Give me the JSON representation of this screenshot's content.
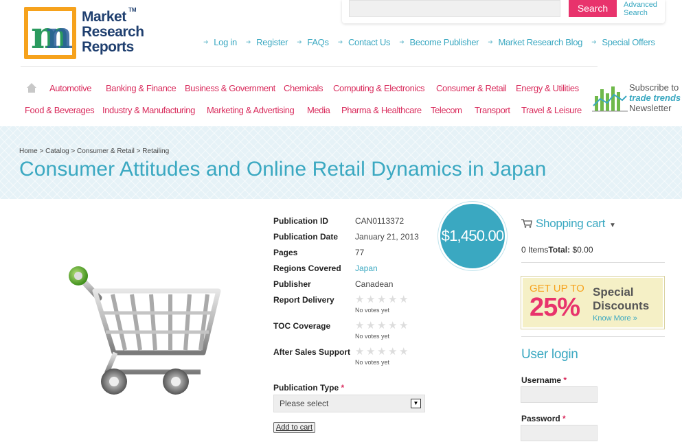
{
  "logo": {
    "line1": "Market",
    "line2": "Research",
    "line3": "Reports",
    "tm": "TM"
  },
  "search": {
    "placeholder": "",
    "button": "Search",
    "advanced": "Advanced Search"
  },
  "topnav": [
    "Log in",
    "Register",
    "FAQs",
    "Contact Us",
    "Become Publisher",
    "Market Research Blog",
    "Special Offers"
  ],
  "categories_row1": [
    "Automotive",
    "Banking & Finance",
    "Business & Government",
    "Chemicals",
    "Computing & Electronics",
    "Consumer & Retail",
    "Energy & Utilities"
  ],
  "categories_row2": [
    "Food & Beverages",
    "Industry & Manufacturing",
    "Marketing & Advertising",
    "Media",
    "Pharma & Healthcare",
    "Telecom",
    "Transport",
    "Travel & Leisure"
  ],
  "newsletter": {
    "line1": "Subscribe to",
    "line2": "trade trends",
    "line3": "Newsletter"
  },
  "breadcrumb": [
    "Home",
    "Catalog",
    "Consumer & Retail",
    "Retailing"
  ],
  "title": "Consumer Attitudes and Online Retail Dynamics in Japan",
  "price": "$1,450.00",
  "details": {
    "pub_id_label": "Publication ID",
    "pub_id": "CAN0113372",
    "pub_date_label": "Publication Date",
    "pub_date": "January 21, 2013",
    "pages_label": "Pages",
    "pages": "77",
    "regions_label": "Regions Covered",
    "regions": "Japan",
    "publisher_label": "Publisher",
    "publisher": "Canadean",
    "delivery_label": "Report Delivery",
    "toc_label": "TOC Coverage",
    "support_label": "After Sales Support",
    "no_votes": "No votes yet"
  },
  "pubtype": {
    "label": "Publication Type",
    "required": "*",
    "selected": "Please select"
  },
  "add_to_cart": "Add to cart",
  "cart": {
    "title": "Shopping cart",
    "items": "0 Items",
    "total_label": "Total:",
    "total": "$0.00"
  },
  "promo": {
    "get": "GET UP TO",
    "percent": "25%",
    "special": "Special",
    "discounts": "Discounts",
    "know_more": "Know More »"
  },
  "login": {
    "title": "User login",
    "username": "Username",
    "password": "Password",
    "required": "*"
  },
  "colors": {
    "accent": "#3aa8c1",
    "pink": "#d92b5c",
    "button": "#e8336c"
  }
}
